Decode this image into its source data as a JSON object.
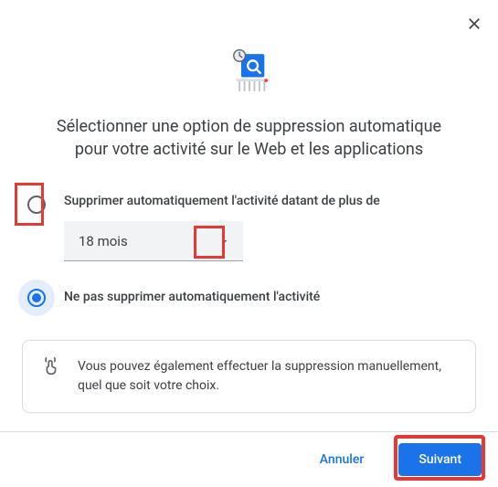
{
  "dialog": {
    "title": "Sélectionner une option de suppression automatique pour votre activité sur le Web et les applications"
  },
  "options": {
    "auto_delete": {
      "label": "Supprimer automatiquement l'activité datant de plus de",
      "selected_value": "18 mois"
    },
    "no_auto_delete": {
      "label": "Ne pas supprimer automatiquement l'activité"
    }
  },
  "info": {
    "text": "Vous pouvez également effectuer la suppression manuellement, quel que soit votre choix."
  },
  "footer": {
    "cancel": "Annuler",
    "next": "Suivant"
  }
}
